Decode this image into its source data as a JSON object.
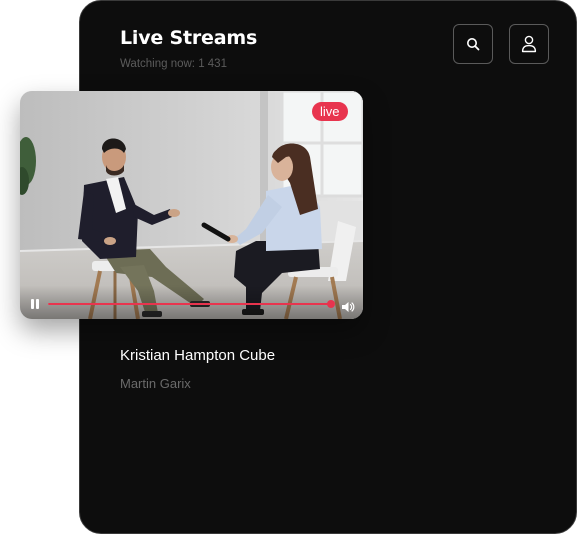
{
  "header": {
    "title": "Live Streams",
    "watching": "Watching now: 1 431"
  },
  "icons": {
    "search": "search-icon",
    "user": "user-icon",
    "pause": "pause-icon",
    "volume": "volume-icon"
  },
  "video": {
    "live_label": "live",
    "progress": 0.985
  },
  "stream": {
    "title": "Kristian Hampton Cube",
    "artist": "Martin Garix"
  },
  "colors": {
    "accent": "#e8344e",
    "background": "#0d0d0d",
    "muted_text": "#5c5c5c"
  }
}
